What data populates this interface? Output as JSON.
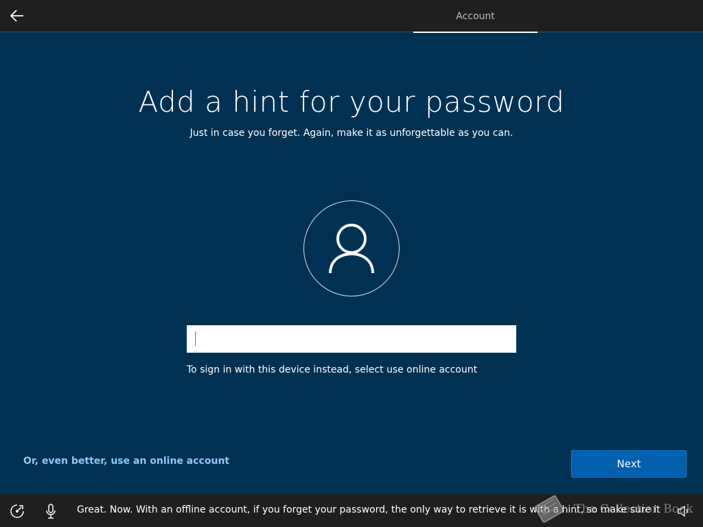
{
  "header": {
    "tab_label": "Account"
  },
  "main": {
    "title": "Add a hint for your password",
    "subtitle": "Just in case you forget. Again, make it as unforgettable as you can.",
    "hint_input_value": "",
    "helper_text": "To sign in with this device instead, select use online account",
    "online_link": "Or, even better, use an online account",
    "next_button": "Next"
  },
  "footer": {
    "narration": "Great. Now. With an offline account, if you forget your password, the only way to retrieve it is with a hint, so make sure it's mem..."
  },
  "watermark": {
    "text": "The Collection Book"
  },
  "icons": {
    "back": "back-arrow-icon",
    "avatar": "user-icon",
    "ease_of_access": "ease-of-access-icon",
    "microphone": "microphone-icon",
    "volume": "volume-icon"
  },
  "colors": {
    "background": "#003152",
    "bar": "#1f1f1f",
    "accent_button": "#0060b0",
    "link": "#8ec8f5"
  }
}
